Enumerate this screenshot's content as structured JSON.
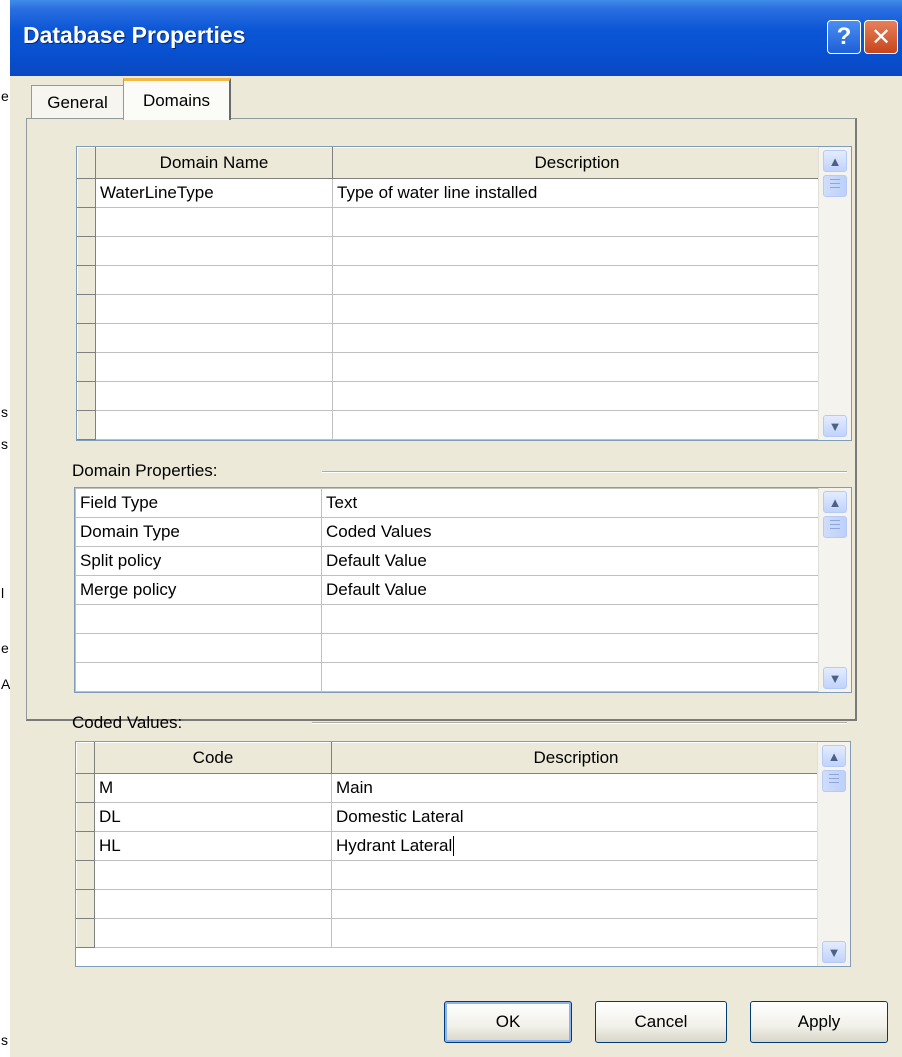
{
  "window": {
    "title": "Database Properties"
  },
  "titlebar_buttons": {
    "help": "?",
    "close": "✕"
  },
  "tabs": [
    {
      "label": "General"
    },
    {
      "label": "Domains"
    }
  ],
  "domains_grid": {
    "columns": [
      "Domain Name",
      "Description"
    ],
    "rows": [
      [
        "WaterLineType",
        "Type of water line installed"
      ],
      [
        "",
        ""
      ],
      [
        "",
        ""
      ],
      [
        "",
        ""
      ],
      [
        "",
        ""
      ],
      [
        "",
        ""
      ],
      [
        "",
        ""
      ],
      [
        "",
        ""
      ],
      [
        "",
        ""
      ]
    ]
  },
  "domain_properties": {
    "label": "Domain Properties:",
    "rows": [
      [
        "Field Type",
        "Text"
      ],
      [
        "Domain Type",
        "Coded Values"
      ],
      [
        "Split policy",
        "Default Value"
      ],
      [
        "Merge policy",
        "Default Value"
      ],
      [
        "",
        ""
      ],
      [
        "",
        ""
      ],
      [
        "",
        ""
      ]
    ]
  },
  "coded_values": {
    "label": "Coded Values:",
    "columns": [
      "Code",
      "Description"
    ],
    "rows": [
      [
        "M",
        "Main"
      ],
      [
        "DL",
        "Domestic Lateral"
      ],
      [
        "HL",
        "Hydrant Lateral"
      ],
      [
        "",
        ""
      ],
      [
        "",
        ""
      ],
      [
        "",
        ""
      ]
    ]
  },
  "buttons": {
    "ok": "OK",
    "cancel": "Cancel",
    "apply": "Apply"
  },
  "background_artifacts": [
    "e",
    "s",
    "s",
    "l",
    "e",
    "A",
    "s"
  ],
  "icons": {
    "scroll_up": "scroll-up-icon",
    "scroll_down": "scroll-down-icon"
  }
}
